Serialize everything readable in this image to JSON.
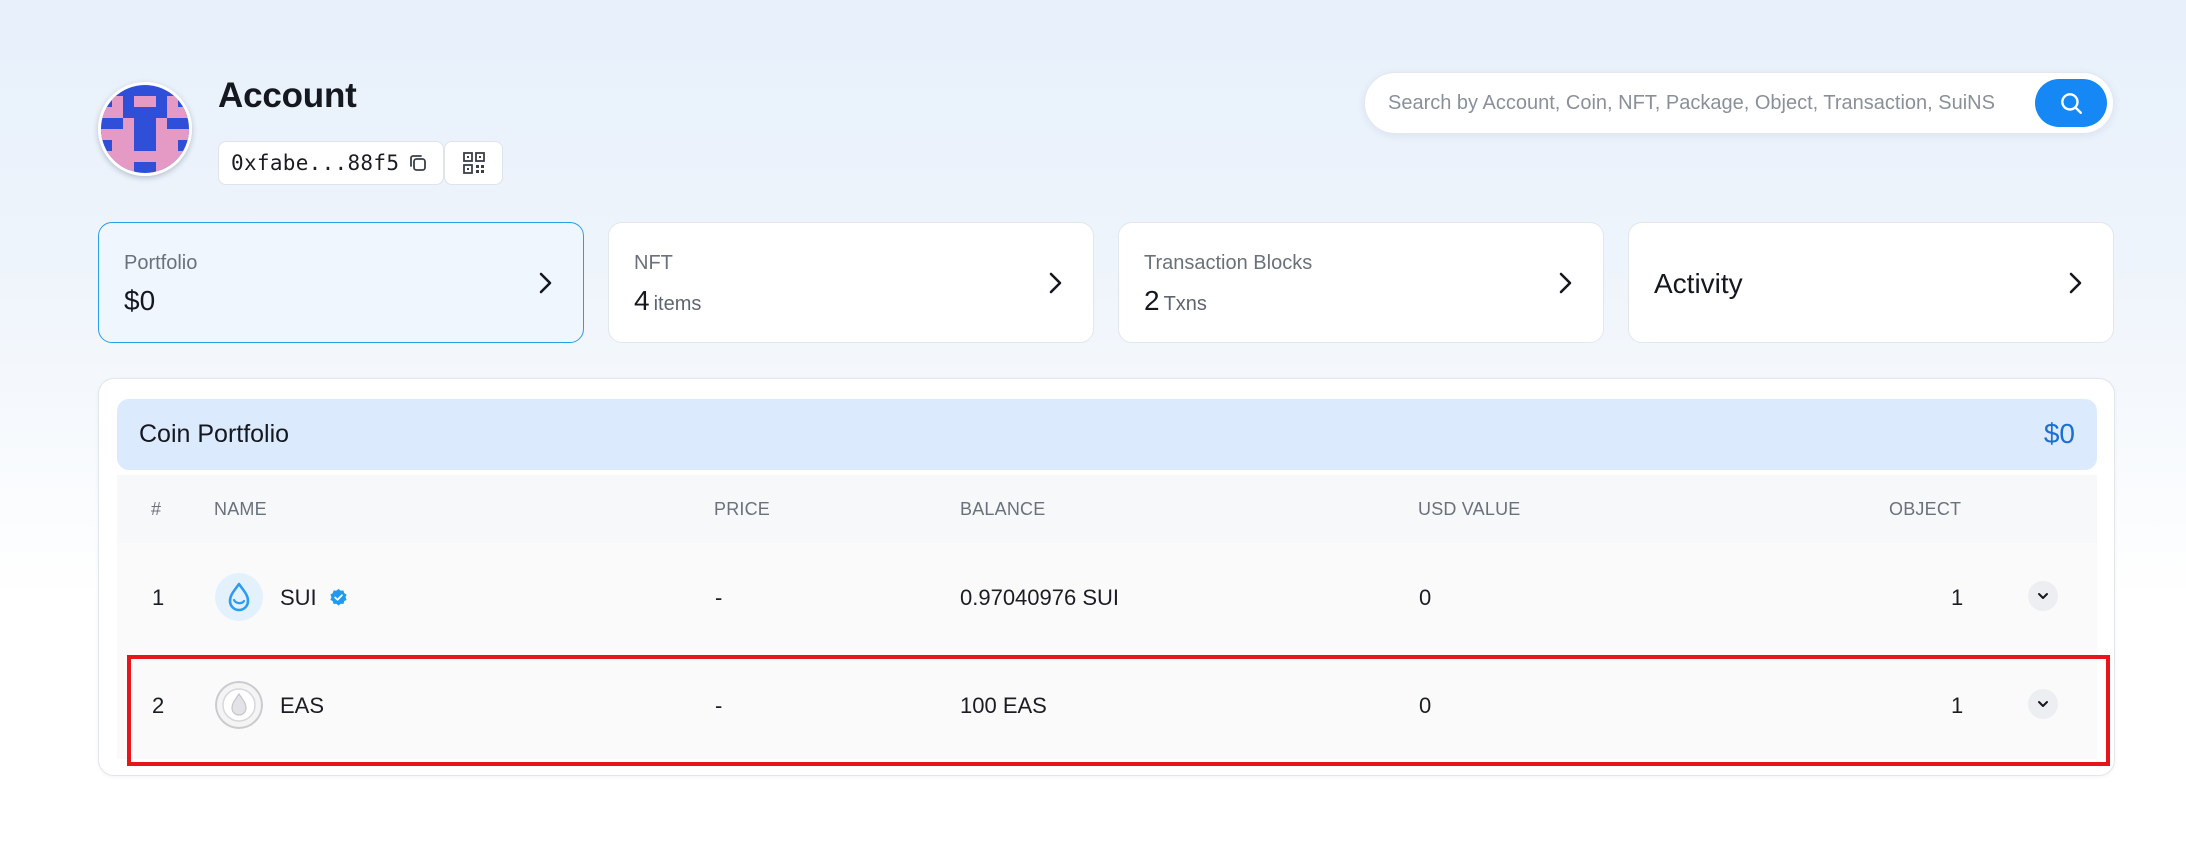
{
  "header": {
    "title": "Account",
    "address": "0xfabe...88f5"
  },
  "search": {
    "placeholder": "Search by Account, Coin, NFT, Package, Object, Transaction, SuiNS"
  },
  "cards": {
    "portfolio": {
      "label": "Portfolio",
      "value": "$0"
    },
    "nft": {
      "label": "NFT",
      "value": "4",
      "unit": "items"
    },
    "transactions": {
      "label": "Transaction Blocks",
      "value": "2",
      "unit": "Txns"
    },
    "activity": {
      "label": "Activity"
    }
  },
  "coin_portfolio": {
    "title": "Coin Portfolio",
    "total": "$0",
    "columns": [
      "#",
      "NAME",
      "PRICE",
      "BALANCE",
      "USD VALUE",
      "OBJECT"
    ],
    "rows": [
      {
        "index": "1",
        "name": "SUI",
        "verified": true,
        "price": "-",
        "balance": "0.97040976 SUI",
        "usd_value": "0",
        "objects": "1",
        "icon": "sui-droplet-icon"
      },
      {
        "index": "2",
        "name": "EAS",
        "verified": false,
        "price": "-",
        "balance": "100 EAS",
        "usd_value": "0",
        "objects": "1",
        "icon": "generic-coin-icon"
      }
    ]
  },
  "colors": {
    "accent": "#1688f5",
    "active_card_border": "#2a9ee6",
    "panel_header_bg": "#dbeafd",
    "highlight": "#e8141b"
  }
}
